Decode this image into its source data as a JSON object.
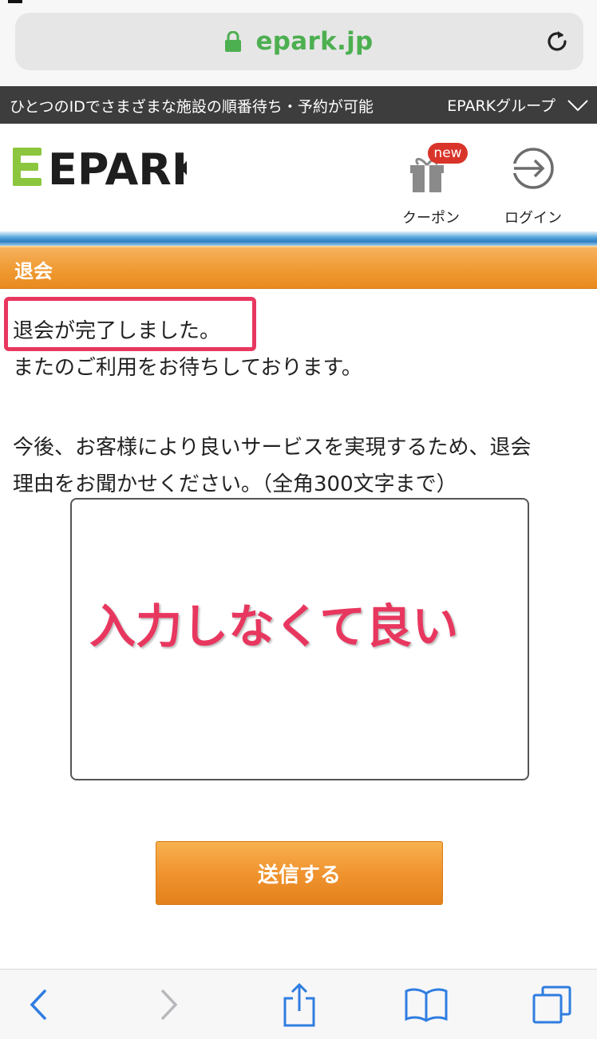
{
  "browser": {
    "url": "epark.jp"
  },
  "group_bar": {
    "tagline": "ひとつのIDでさまざまな施設の順番待ち・予約が可能",
    "group_link": "EPARKグループ"
  },
  "header": {
    "logo": "EPARK",
    "coupon_label": "クーポン",
    "new_badge": "new",
    "login_label": "ログイン"
  },
  "page": {
    "title": "退会",
    "completed_message": "退会が完了しました。",
    "wait_message": "またのご利用をお待ちしております。",
    "reason_line1": "今後、お客様により良いサービスを実現するため、退会",
    "reason_line2": "理由をお聞かせください。（全角300文字まで）",
    "reason_input_value": "",
    "annotation": "入力しなくて良い",
    "submit_label": "送信する"
  },
  "colors": {
    "accent_orange": "#f09c35",
    "highlight_pink": "#e8375f",
    "url_green": "#4caf50",
    "safari_blue": "#2f7de1"
  },
  "icons": {
    "lock": "lock-icon",
    "reload": "reload-icon",
    "chevron": "chevron-down-icon",
    "coupon": "gift-icon",
    "login": "login-arrow-icon",
    "back": "back-chevron-icon",
    "forward": "forward-chevron-icon",
    "share": "share-icon",
    "bookmarks": "bookmarks-icon",
    "tabs": "tabs-icon"
  }
}
